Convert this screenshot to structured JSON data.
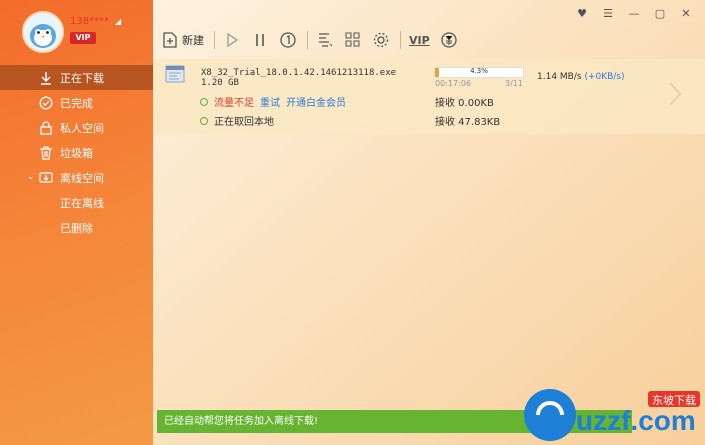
{
  "user": {
    "name": "138****",
    "vip": "VIP"
  },
  "sidebar": {
    "items": [
      {
        "label": "正在下载",
        "icon": "download-icon"
      },
      {
        "label": "已完成",
        "icon": "check-circle-icon"
      },
      {
        "label": "私人空间",
        "icon": "lock-icon"
      },
      {
        "label": "垃圾箱",
        "icon": "trash-icon"
      },
      {
        "label": "离线空间",
        "icon": "cloud-download-icon"
      },
      {
        "label": "正在离线"
      },
      {
        "label": "已删除"
      }
    ]
  },
  "toolbar": {
    "new_label": "新建",
    "vip_label": "VIP"
  },
  "task": {
    "file_name": "X8_32_Trial_18.0.1.42.1461213118.exe",
    "file_size": "1.20 GB",
    "progress": 4.3,
    "progress_text": "4.3%",
    "elapsed": "00:17:06",
    "count": "3/11",
    "speed": "1.14  MB/s",
    "speed_extra": "(+0KB/s)",
    "status_warning": "流量不足",
    "retry": "重试",
    "upgrade": "开通白金会员",
    "recv1": "接收 0.00KB",
    "status2": "正在取回本地",
    "recv2": "接收 47.83KB"
  },
  "notice": "已经自动帮您将任务加入离线下载!",
  "watermark": {
    "brand": "uzzf.com",
    "cn": "东坡下载"
  },
  "colors": {
    "accent": "#f5863a",
    "active_nav": "#b8541f",
    "notice_bg": "#67b332",
    "progress": "#e0a73a"
  }
}
